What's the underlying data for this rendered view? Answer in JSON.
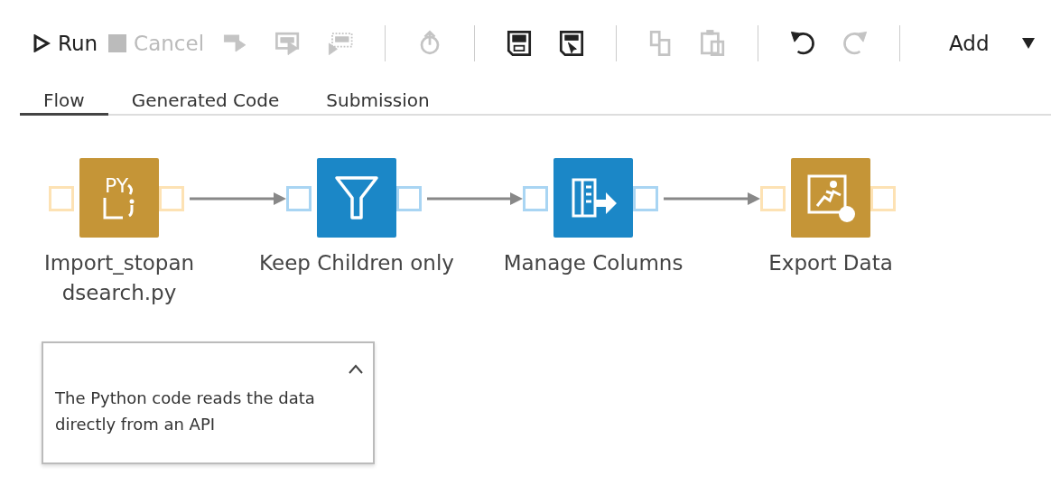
{
  "toolbar": [
    {
      "kind": "button",
      "label": "Run",
      "disabled": false
    },
    {
      "kind": "button",
      "label": "Cancel",
      "disabled": true
    },
    {
      "kind": "icon",
      "disabled": true
    },
    {
      "kind": "icon",
      "disabled": true
    },
    {
      "kind": "icon",
      "disabled": true
    },
    {
      "kind": "separator"
    },
    {
      "kind": "icon",
      "disabled": true
    },
    {
      "kind": "separator"
    },
    {
      "kind": "icon",
      "disabled": false
    },
    {
      "kind": "icon",
      "disabled": false
    },
    {
      "kind": "separator"
    },
    {
      "kind": "icon",
      "disabled": true
    },
    {
      "kind": "icon",
      "disabled": true
    },
    {
      "kind": "separator"
    },
    {
      "kind": "icon",
      "disabled": false
    },
    {
      "kind": "icon",
      "disabled": true
    },
    {
      "kind": "separator"
    },
    {
      "kind": "menu",
      "label": "Add"
    }
  ],
  "tabs": [
    {
      "label": "Flow",
      "selected": true
    },
    {
      "label": "Generated Code",
      "selected": false
    },
    {
      "label": "Submission",
      "selected": false
    }
  ],
  "flow": {
    "nodes": [
      {
        "kind": "python",
        "badge": "PY",
        "label": "Import_stopan dsearch.py",
        "color": "#c59537"
      },
      {
        "kind": "filter",
        "label": "Keep Children only",
        "color": "#1b87c7"
      },
      {
        "kind": "columns",
        "label": "Manage Columns",
        "color": "#1b87c7"
      },
      {
        "kind": "export",
        "label": "Export Data",
        "color": "#c59537"
      }
    ],
    "note": {
      "text": "The Python code reads the data directly from an API",
      "expanded": true
    }
  }
}
